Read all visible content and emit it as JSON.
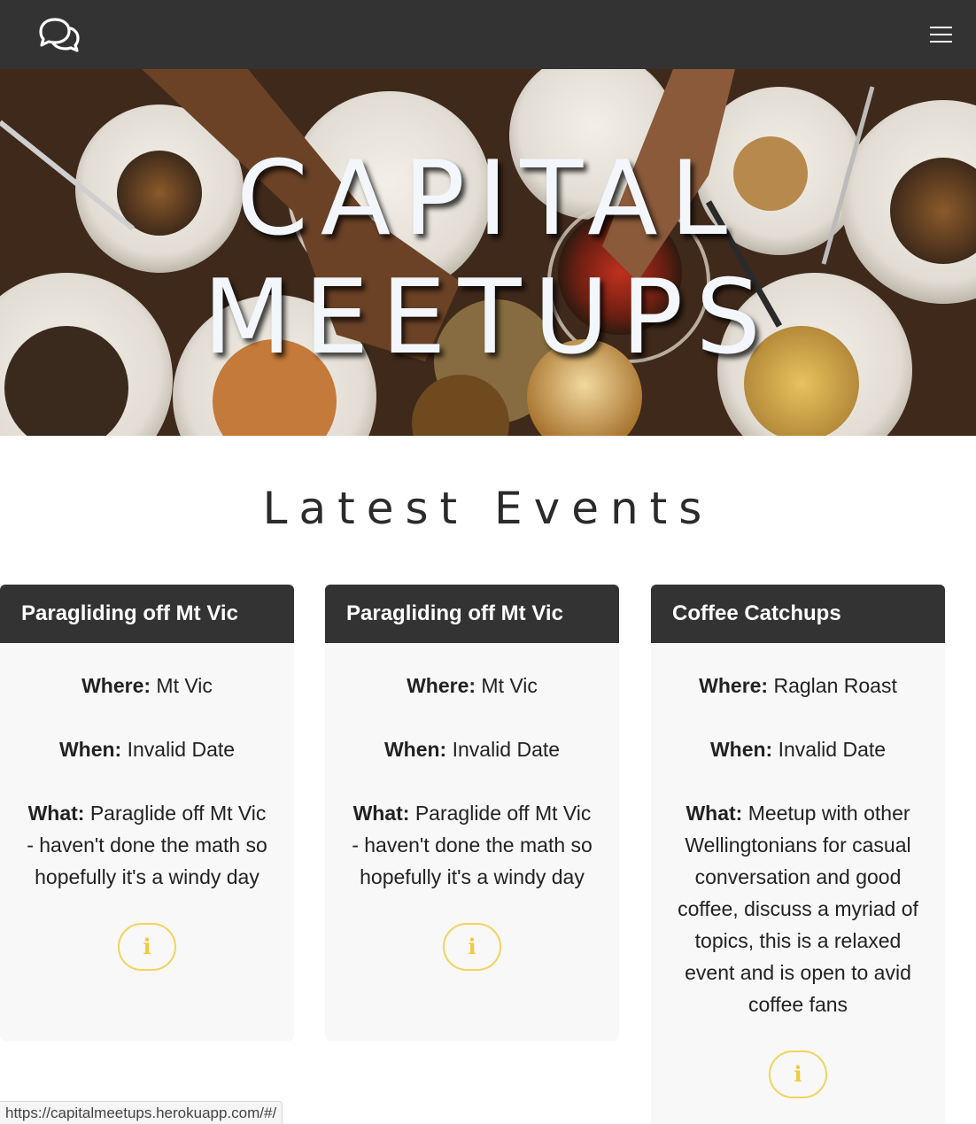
{
  "nav": {
    "logo_icon": "chat-bubbles-icon",
    "menu_icon": "hamburger-icon"
  },
  "hero": {
    "line1": "CAPITAL",
    "line2": "MEETUPS"
  },
  "events_section": {
    "title": "Latest Events",
    "where_label": "Where:",
    "when_label": "When:",
    "what_label": "What:",
    "info_glyph": "i",
    "events": [
      {
        "title": "Paragliding off Mt Vic",
        "where": "Mt Vic",
        "when": "Invalid Date",
        "what": "Paraglide off Mt Vic - haven't done the math so hopefully it's a windy day"
      },
      {
        "title": "Paragliding off Mt Vic",
        "where": "Mt Vic",
        "when": "Invalid Date",
        "what": "Paraglide off Mt Vic - haven't done the math so hopefully it's a windy day"
      },
      {
        "title": "Coffee Catchups",
        "where": "Raglan Roast",
        "when": "Invalid Date",
        "what": "Meetup with other Wellingtonians for casual conversation and good coffee, discuss a myriad of topics, this is a relaxed event and is open to avid coffee fans"
      }
    ]
  },
  "status_bar": {
    "url": "https://capitalmeetups.herokuapp.com/#/"
  },
  "colors": {
    "nav_bg": "#333333",
    "card_bg": "#f8f8f8",
    "accent": "#f3d35c"
  }
}
